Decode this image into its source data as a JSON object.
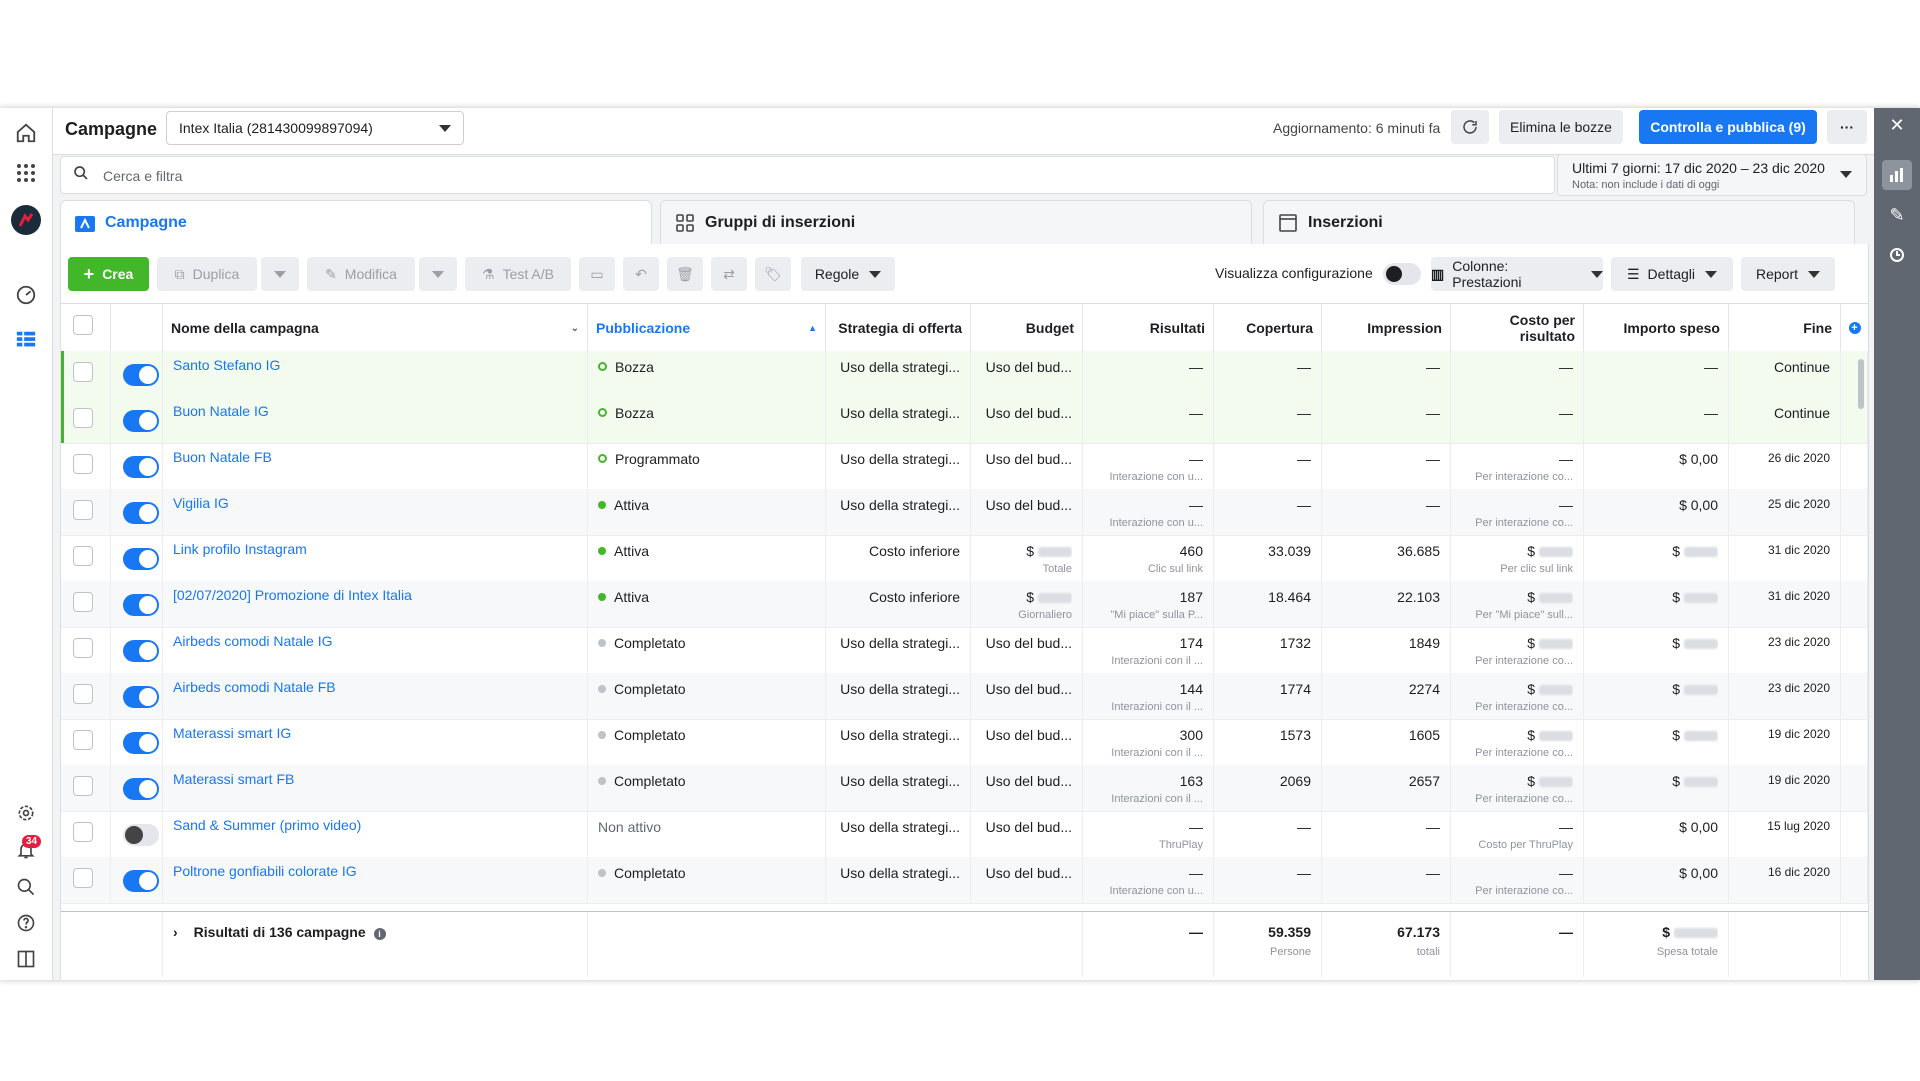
{
  "nav": {
    "badge": "34",
    "icons": [
      "home-icon",
      "apps-grid-icon",
      "account-avatar-icon",
      "dashboard-gauge-icon",
      "table-icon",
      "settings-gear-icon",
      "notifications-bell-icon",
      "search-icon",
      "help-icon",
      "panel-icon"
    ]
  },
  "header": {
    "title": "Campagne",
    "account": "Intex Italia (281430099897094)",
    "update_text": "Aggiornamento: 6 minuti fa",
    "discard_label": "Elimina le bozze",
    "publish_label": "Controlla e pubblica (9)",
    "more_label": "···"
  },
  "search": {
    "placeholder": "Cerca e filtra"
  },
  "date_range": {
    "label": "Ultimi 7 giorni: 17 dic 2020 – 23 dic 2020",
    "note": "Nota: non include i dati di oggi"
  },
  "tabs": [
    {
      "label": "Campagne"
    },
    {
      "label": "Gruppi di inserzioni"
    },
    {
      "label": "Inserzioni"
    }
  ],
  "toolbar": {
    "create": "Crea",
    "duplicate": "Duplica",
    "edit": "Modifica",
    "ab_test": "Test A/B",
    "rules": "Regole",
    "view_setup": "Visualizza configurazione",
    "columns": "Colonne: Prestazioni",
    "details": "Dettagli",
    "report": "Report"
  },
  "table": {
    "headers": {
      "name": "Nome della campagna",
      "delivery": "Pubblicazione",
      "bid": "Strategia di offerta",
      "budget": "Budget",
      "results": "Risultati",
      "reach": "Copertura",
      "impressions": "Impression",
      "cost_line1": "Costo per",
      "cost_line2": "risultato",
      "spent": "Importo speso",
      "end": "Fine"
    },
    "rows": [
      {
        "name": "Santo Stefano IG",
        "status": "Bozza",
        "bid": "Uso della strategi...",
        "budget": "Uso del bud...",
        "budget_sub": "",
        "results": "—",
        "results_sub": "",
        "reach": "—",
        "impressions": "—",
        "cost": "—",
        "cost_sub": "",
        "spent": "—",
        "end": "Continue"
      },
      {
        "name": "Buon Natale IG",
        "status": "Bozza",
        "bid": "Uso della strategi...",
        "budget": "Uso del bud...",
        "budget_sub": "",
        "results": "—",
        "results_sub": "",
        "reach": "—",
        "impressions": "—",
        "cost": "—",
        "cost_sub": "",
        "spent": "—",
        "end": "Continue"
      },
      {
        "name": "Buon Natale FB",
        "status": "Programmato",
        "bid": "Uso della strategi...",
        "budget": "Uso del bud...",
        "budget_sub": "",
        "results": "—",
        "results_sub": "Interazione con u...",
        "reach": "—",
        "impressions": "—",
        "cost": "—",
        "cost_sub": "Per interazione co...",
        "spent": "$ 0,00",
        "end": "26 dic 2020"
      },
      {
        "name": "Vigilia IG",
        "status": "Attiva",
        "bid": "Uso della strategi...",
        "budget": "Uso del bud...",
        "budget_sub": "",
        "results": "—",
        "results_sub": "Interazione con u...",
        "reach": "—",
        "impressions": "—",
        "cost": "—",
        "cost_sub": "Per interazione co...",
        "spent": "$ 0,00",
        "end": "25 dic 2020"
      },
      {
        "name": "Link profilo Instagram",
        "status": "Attiva",
        "bid": "Costo inferiore",
        "budget": "$",
        "budget_sub": "Totale",
        "results": "460",
        "results_sub": "Clic sul link",
        "reach": "33.039",
        "impressions": "36.685",
        "cost": "$",
        "cost_sub": "Per clic sul link",
        "spent": "$",
        "end": "31 dic 2020"
      },
      {
        "name": "[02/07/2020] Promozione di Intex Italia",
        "status": "Attiva",
        "bid": "Costo inferiore",
        "budget": "$",
        "budget_sub": "Giornaliero",
        "results": "187",
        "results_sub": "\"Mi piace\" sulla P...",
        "reach": "18.464",
        "impressions": "22.103",
        "cost": "$",
        "cost_sub": "Per \"Mi piace\" sull...",
        "spent": "$",
        "end": "31 dic 2020"
      },
      {
        "name": "Airbeds comodi Natale IG",
        "status": "Completato",
        "bid": "Uso della strategi...",
        "budget": "Uso del bud...",
        "budget_sub": "",
        "results": "174",
        "results_sub": "Interazioni con il ...",
        "reach": "1732",
        "impressions": "1849",
        "cost": "$",
        "cost_sub": "Per interazione co...",
        "spent": "$",
        "end": "23 dic 2020"
      },
      {
        "name": "Airbeds comodi Natale FB",
        "status": "Completato",
        "bid": "Uso della strategi...",
        "budget": "Uso del bud...",
        "budget_sub": "",
        "results": "144",
        "results_sub": "Interazioni con il ...",
        "reach": "1774",
        "impressions": "2274",
        "cost": "$",
        "cost_sub": "Per interazione co...",
        "spent": "$",
        "end": "23 dic 2020"
      },
      {
        "name": "Materassi smart IG",
        "status": "Completato",
        "bid": "Uso della strategi...",
        "budget": "Uso del bud...",
        "budget_sub": "",
        "results": "300",
        "results_sub": "Interazioni con il ...",
        "reach": "1573",
        "impressions": "1605",
        "cost": "$",
        "cost_sub": "Per interazione co...",
        "spent": "$",
        "end": "19 dic 2020"
      },
      {
        "name": "Materassi smart FB",
        "status": "Completato",
        "bid": "Uso della strategi...",
        "budget": "Uso del bud...",
        "budget_sub": "",
        "results": "163",
        "results_sub": "Interazioni con il ...",
        "reach": "2069",
        "impressions": "2657",
        "cost": "$",
        "cost_sub": "Per interazione co...",
        "spent": "$",
        "end": "19 dic 2020"
      },
      {
        "name": "Sand & Summer (primo video)",
        "status": "Non attivo",
        "bid": "Uso della strategi...",
        "budget": "Uso del bud...",
        "budget_sub": "",
        "results": "—",
        "results_sub": "ThruPlay",
        "reach": "—",
        "impressions": "—",
        "cost": "—",
        "cost_sub": "Costo per ThruPlay",
        "spent": "$ 0,00",
        "end": "15 lug 2020"
      },
      {
        "name": "Poltrone gonfiabili colorate IG",
        "status": "Completato",
        "bid": "Uso della strategi...",
        "budget": "Uso del bud...",
        "budget_sub": "",
        "results": "—",
        "results_sub": "Interazione con u...",
        "reach": "—",
        "impressions": "—",
        "cost": "—",
        "cost_sub": "Per interazione co...",
        "spent": "$ 0,00",
        "end": "16 dic 2020"
      }
    ],
    "footer": {
      "label": "Risultati di 136 campagne",
      "results": "—",
      "reach": "59.359",
      "reach_sub": "Persone",
      "impressions": "67.173",
      "impressions_sub": "totali",
      "cost": "—",
      "spent": "$",
      "spent_sub": "Spesa totale"
    }
  },
  "colors": {
    "accent": "#1877f2",
    "create_green": "#42b72a",
    "draft_row": "#f3faee"
  }
}
